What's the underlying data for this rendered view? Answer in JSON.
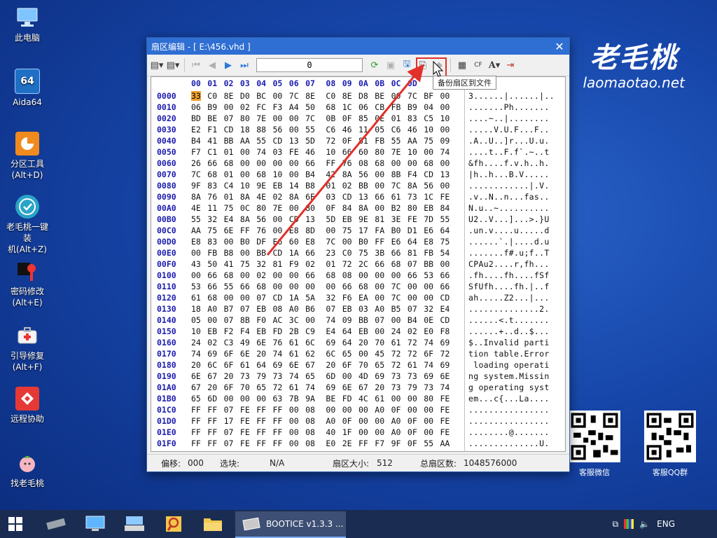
{
  "desktop": {
    "icons": [
      {
        "label": "此电脑"
      },
      {
        "label": "Aida64"
      },
      {
        "label": "分区工具\n(Alt+D)"
      },
      {
        "label": "老毛桃一键装\n机(Alt+Z)"
      },
      {
        "label": "密码修改\n(Alt+E)"
      },
      {
        "label": "引导修复\n(Alt+F)"
      },
      {
        "label": "远程协助"
      },
      {
        "label": "找老毛桃"
      }
    ],
    "aida_text": "64"
  },
  "brand": {
    "cn": "老毛桃",
    "url": "laomaotao.net"
  },
  "qr": {
    "wechat_label": "客服微信",
    "qq_label": "客服QQ群"
  },
  "window": {
    "title": "扇区编辑 - [ E:\\456.vhd ]",
    "sector_value": "0",
    "tooltip": "备份扇区到文件",
    "hex_header": [
      "00",
      "01",
      "02",
      "03",
      "04",
      "05",
      "06",
      "07",
      "08",
      "09",
      "0A",
      "0B",
      "0C",
      "0D"
    ],
    "rows": [
      {
        "addr": "0000",
        "bytes": "33 C0 8E D0 BC 00 7C 8E C0 8E D8 BE 00 7C BF 00",
        "ascii": "3......|......|.."
      },
      {
        "addr": "0010",
        "bytes": "06 B9 00 02 FC F3 A4 50 68 1C 06 CB FB B9 04 00",
        "ascii": ".......Ph......."
      },
      {
        "addr": "0020",
        "bytes": "BD BE 07 80 7E 00 00 7C 0B 0F 85 0E 01 83 C5 10",
        "ascii": "....~..|........"
      },
      {
        "addr": "0030",
        "bytes": "E2 F1 CD 18 88 56 00 55 C6 46 11 05 C6 46 10 00",
        "ascii": ".....V.U.F...F.."
      },
      {
        "addr": "0040",
        "bytes": "B4 41 BB AA 55 CD 13 5D 72 0F 81 FB 55 AA 75 09",
        "ascii": ".A..U..]r...U.u."
      },
      {
        "addr": "0050",
        "bytes": "F7 C1 01 00 74 03 FE 46 10 66 60 80 7E 10 00 74",
        "ascii": "....t..F.f`.~..t"
      },
      {
        "addr": "0060",
        "bytes": "26 66 68 00 00 00 00 66 FF 76 08 68 00 00 68 00",
        "ascii": "&fh....f.v.h..h."
      },
      {
        "addr": "0070",
        "bytes": "7C 68 01 00 68 10 00 B4 42 8A 56 00 8B F4 CD 13",
        "ascii": "|h..h...B.V....."
      },
      {
        "addr": "0080",
        "bytes": "9F 83 C4 10 9E EB 14 B8 01 02 BB 00 7C 8A 56 00",
        "ascii": "............|.V."
      },
      {
        "addr": "0090",
        "bytes": "8A 76 01 8A 4E 02 8A 6E 03 CD 13 66 61 73 1C FE",
        "ascii": ".v..N..n...fas.."
      },
      {
        "addr": "00A0",
        "bytes": "4E 11 75 0C 80 7E 00 80 0F 84 8A 00 B2 80 EB 84",
        "ascii": "N.u..~.........."
      },
      {
        "addr": "00B0",
        "bytes": "55 32 E4 8A 56 00 CD 13 5D EB 9E 81 3E FE 7D 55",
        "ascii": "U2..V...]...>.}U"
      },
      {
        "addr": "00C0",
        "bytes": "AA 75 6E FF 76 00 E8 8D 00 75 17 FA B0 D1 E6 64",
        "ascii": ".un.v....u.....d"
      },
      {
        "addr": "00D0",
        "bytes": "E8 83 00 B0 DF E6 60 E8 7C 00 B0 FF E6 64 E8 75",
        "ascii": "......`.|....d.u"
      },
      {
        "addr": "00E0",
        "bytes": "00 FB B8 00 BB CD 1A 66 23 C0 75 3B 66 81 FB 54",
        "ascii": ".......f#.u;f..T"
      },
      {
        "addr": "00F0",
        "bytes": "43 50 41 75 32 81 F9 02 01 72 2C 66 68 07 BB 00",
        "ascii": "CPAu2....r,fh..."
      },
      {
        "addr": "0100",
        "bytes": "00 66 68 00 02 00 00 66 68 08 00 00 00 66 53 66",
        "ascii": ".fh....fh....fSf"
      },
      {
        "addr": "0110",
        "bytes": "53 66 55 66 68 00 00 00 00 66 68 00 7C 00 00 66",
        "ascii": "SfUfh....fh.|..f"
      },
      {
        "addr": "0120",
        "bytes": "61 68 00 00 07 CD 1A 5A 32 F6 EA 00 7C 00 00 CD",
        "ascii": "ah.....Z2...|..."
      },
      {
        "addr": "0130",
        "bytes": "18 A0 B7 07 EB 08 A0 B6 07 EB 03 A0 B5 07 32 E4",
        "ascii": "..............2."
      },
      {
        "addr": "0140",
        "bytes": "05 00 07 8B F0 AC 3C 00 74 09 BB 07 00 B4 0E CD",
        "ascii": "......<.t......."
      },
      {
        "addr": "0150",
        "bytes": "10 EB F2 F4 EB FD 2B C9 E4 64 EB 00 24 02 E0 F8",
        "ascii": "......+..d..$..."
      },
      {
        "addr": "0160",
        "bytes": "24 02 C3 49 6E 76 61 6C 69 64 20 70 61 72 74 69",
        "ascii": "$..Invalid parti"
      },
      {
        "addr": "0170",
        "bytes": "74 69 6F 6E 20 74 61 62 6C 65 00 45 72 72 6F 72",
        "ascii": "tion table.Error"
      },
      {
        "addr": "0180",
        "bytes": "20 6C 6F 61 64 69 6E 67 20 6F 70 65 72 61 74 69",
        "ascii": " loading operati"
      },
      {
        "addr": "0190",
        "bytes": "6E 67 20 73 79 73 74 65 6D 00 4D 69 73 73 69 6E",
        "ascii": "ng system.Missin"
      },
      {
        "addr": "01A0",
        "bytes": "67 20 6F 70 65 72 61 74 69 6E 67 20 73 79 73 74",
        "ascii": "g operating syst"
      },
      {
        "addr": "01B0",
        "bytes": "65 6D 00 00 00 63 7B 9A BE FD 4C 61 00 00 80 FE",
        "ascii": "em...c{...La...."
      },
      {
        "addr": "01C0",
        "bytes": "FF FF 07 FE FF FF 00 08 00 00 00 A0 0F 00 00 FE",
        "ascii": "................"
      },
      {
        "addr": "01D0",
        "bytes": "FF FF 17 FE FF FF 00 08 A0 0F 00 00 A0 0F 00 FE",
        "ascii": "................"
      },
      {
        "addr": "01E0",
        "bytes": "FF FF 07 FE FF FF 00 08 40 1F 00 00 A0 0F 00 FE",
        "ascii": "........@......."
      },
      {
        "addr": "01F0",
        "bytes": "FF FF 07 FE FF FF 00 08 E0 2E FF F7 9F 0F 55 AA",
        "ascii": "..............U."
      }
    ],
    "status": {
      "offset_label": "偏移:",
      "offset_value": "000",
      "block_label": "选块:",
      "block_value": "N/A",
      "sector_size_label": "扇区大小:",
      "sector_size_value": "512",
      "total_label": "总扇区数:",
      "total_value": "1048576000"
    }
  },
  "taskbar": {
    "active_task": "BOOTICE v1.3.3 ...",
    "lang": "ENG"
  },
  "colors": {
    "accent": "#2f6ed2",
    "highlight_box": "#e2302a",
    "arrow": "#e2302a"
  }
}
